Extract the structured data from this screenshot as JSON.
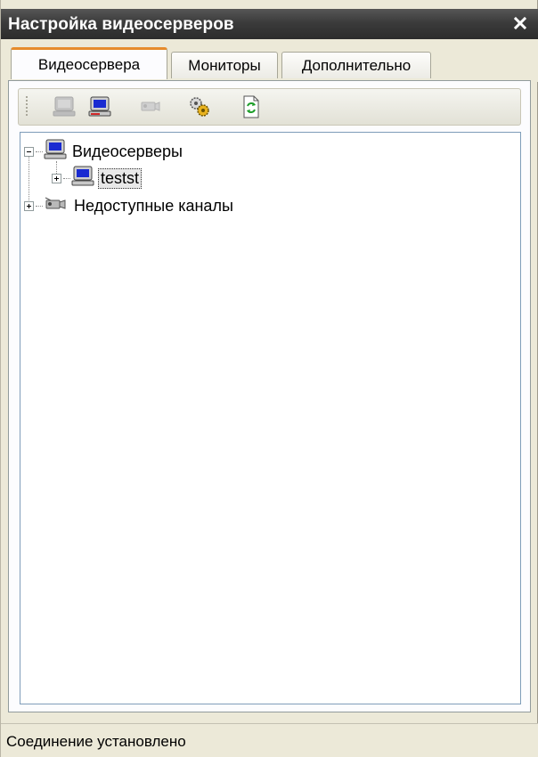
{
  "window": {
    "title": "Настройка видеосерверов",
    "close_icon": "close-icon"
  },
  "tabs": [
    {
      "label": "Видеосервера",
      "active": true
    },
    {
      "label": "Мониторы",
      "active": false
    },
    {
      "label": "Дополнительно",
      "active": false
    }
  ],
  "toolbar": {
    "buttons": [
      {
        "icon": "server-disabled-icon",
        "enabled": false
      },
      {
        "icon": "server-add-icon",
        "enabled": true
      },
      {
        "icon": "camera-disabled-icon",
        "enabled": false
      },
      {
        "icon": "gears-icon",
        "enabled": true
      },
      {
        "icon": "refresh-icon",
        "enabled": true
      }
    ]
  },
  "tree": {
    "root": {
      "label": "Видеосерверы",
      "expanded": true,
      "icon": "computer-icon"
    },
    "child": {
      "label": "testst",
      "expanded": false,
      "selected": true,
      "icon": "computer-icon"
    },
    "unavailable": {
      "label": "Недоступные каналы",
      "expanded": false,
      "icon": "camera-icon"
    }
  },
  "status": {
    "text": "Соединение установлено"
  }
}
